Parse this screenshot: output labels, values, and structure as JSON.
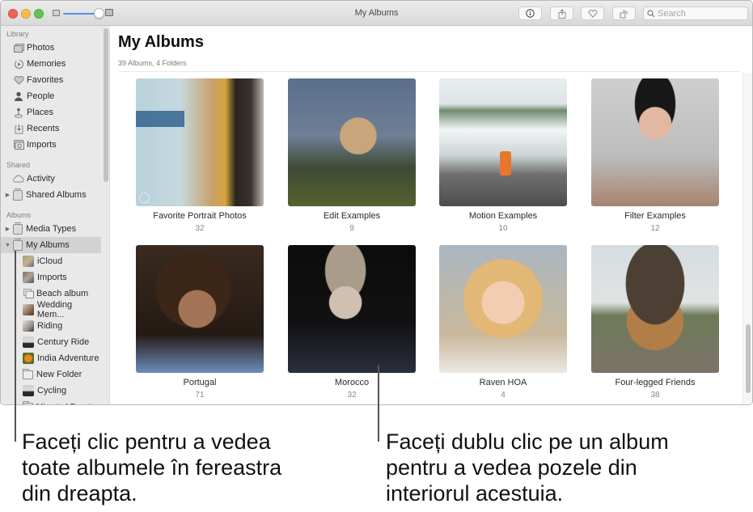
{
  "window": {
    "title": "My Albums",
    "search_placeholder": "Search",
    "toolbar": {
      "info_icon": "info-icon",
      "share_icon": "share-icon",
      "favorite_icon": "heart-icon",
      "rotate_icon": "rotate-icon"
    }
  },
  "sidebar": {
    "sections": [
      {
        "header": "Library",
        "items": [
          {
            "label": "Photos",
            "icon": "photos-icon"
          },
          {
            "label": "Memories",
            "icon": "memories-icon"
          },
          {
            "label": "Favorites",
            "icon": "heart-icon"
          },
          {
            "label": "People",
            "icon": "person-icon"
          },
          {
            "label": "Places",
            "icon": "pin-icon"
          },
          {
            "label": "Recents",
            "icon": "recents-icon"
          },
          {
            "label": "Imports",
            "icon": "camera-icon"
          }
        ]
      },
      {
        "header": "Shared",
        "items": [
          {
            "label": "Activity",
            "icon": "cloud-icon"
          },
          {
            "label": "Shared Albums",
            "icon": "album-icon",
            "disclosure": "collapsed"
          }
        ]
      },
      {
        "header": "Albums",
        "items": [
          {
            "label": "Media Types",
            "icon": "album-icon",
            "disclosure": "collapsed"
          },
          {
            "label": "My Albums",
            "icon": "album-icon",
            "disclosure": "expanded",
            "selected": true
          }
        ]
      }
    ],
    "my_albums_children": [
      {
        "label": "iCloud",
        "type": "album"
      },
      {
        "label": "Imports",
        "type": "album"
      },
      {
        "label": "Beach album",
        "type": "smart"
      },
      {
        "label": "Wedding Mem...",
        "type": "album"
      },
      {
        "label": "Riding",
        "type": "album"
      },
      {
        "label": "Century Ride",
        "type": "album"
      },
      {
        "label": "India Adventure",
        "type": "album"
      },
      {
        "label": "New Folder",
        "type": "folder"
      },
      {
        "label": "Cycling",
        "type": "album"
      },
      {
        "label": "Migrated Events",
        "type": "folder"
      }
    ]
  },
  "main": {
    "title": "My Albums",
    "subtitle": "39 Albums, 4 Folders",
    "albums": [
      {
        "name": "Favorite Portrait Photos",
        "count": "32"
      },
      {
        "name": "Edit Examples",
        "count": "9"
      },
      {
        "name": "Motion Examples",
        "count": "10"
      },
      {
        "name": "Filter Examples",
        "count": "12"
      },
      {
        "name": "Portugal",
        "count": "71"
      },
      {
        "name": "Morocco",
        "count": "32"
      },
      {
        "name": "Raven HOA",
        "count": "4"
      },
      {
        "name": "Four-legged Friends",
        "count": "38"
      }
    ]
  },
  "callouts": {
    "left": [
      "Faceți clic pentru a vedea",
      "toate albumele în fereastra",
      "din dreapta."
    ],
    "right": [
      "Faceți dublu clic pe un album",
      "pentru a vedea pozele din",
      "interiorul acestuia."
    ]
  }
}
